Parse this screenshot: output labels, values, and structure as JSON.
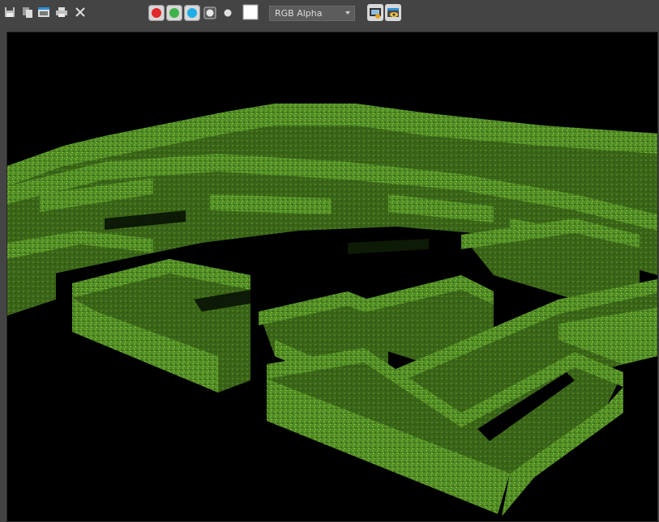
{
  "toolbar": {
    "icons": [
      "save-icon",
      "copy-icon",
      "clone-icon",
      "print-icon",
      "close-icon",
      "red-channel-icon",
      "green-channel-icon",
      "blue-channel-icon",
      "alpha-channel-icon",
      "mono-icon",
      "swatch-icon",
      "display-toggle-icon",
      "view-options-icon"
    ],
    "channel_colors": {
      "red": "#e02a2a",
      "green": "#3fb34a",
      "blue": "#1eaee5"
    },
    "channel_select": {
      "value": "RGB Alpha"
    }
  },
  "viewport": {
    "background": "#000000",
    "hedge_colors": [
      "#3f6e1c",
      "#4f8a24",
      "#6aa831",
      "#86c43f"
    ]
  }
}
